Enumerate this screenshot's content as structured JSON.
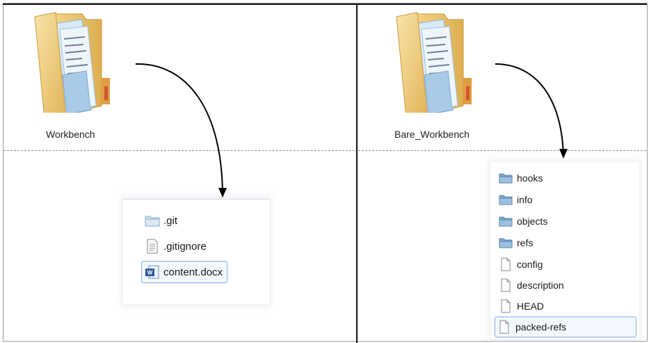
{
  "left_pane": {
    "folder": {
      "label": "Workbench",
      "icon": "documents-folder-icon"
    },
    "items": [
      {
        "label": ".git",
        "icon": "folder-icon"
      },
      {
        "label": ".gitignore",
        "icon": "text-file-icon"
      },
      {
        "label": "content.docx",
        "icon": "word-document-icon",
        "selected": true
      }
    ]
  },
  "right_pane": {
    "folder": {
      "label": "Bare_Workbench",
      "icon": "documents-folder-icon"
    },
    "items": [
      {
        "label": "hooks",
        "icon": "folder-icon"
      },
      {
        "label": "info",
        "icon": "folder-icon"
      },
      {
        "label": "objects",
        "icon": "folder-icon"
      },
      {
        "label": "refs",
        "icon": "folder-icon"
      },
      {
        "label": "config",
        "icon": "file-icon"
      },
      {
        "label": "description",
        "icon": "file-icon"
      },
      {
        "label": "HEAD",
        "icon": "file-icon"
      },
      {
        "label": "packed-refs",
        "icon": "file-icon",
        "selected": true
      }
    ]
  },
  "colors": {
    "folder_tan": "#e9c46f",
    "folder_blue": "#8fb6d9",
    "selection_border": "#84acdd",
    "divider": "#111111"
  }
}
